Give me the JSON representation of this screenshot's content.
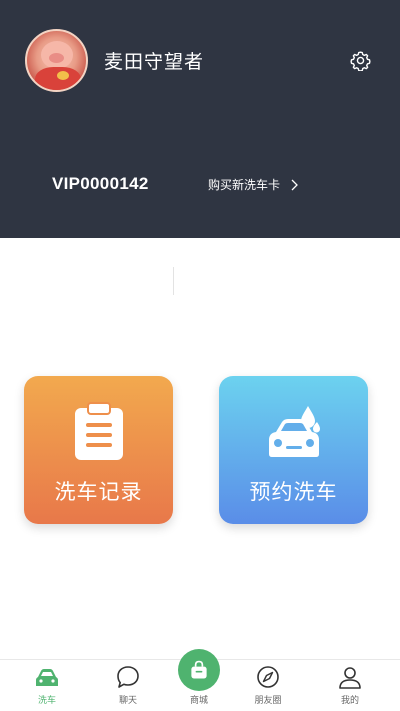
{
  "profile": {
    "username": "麦田守望者",
    "vip_id": "VIP0000142",
    "buy_card_label": "购买新洗车卡"
  },
  "tiles": [
    {
      "label": "洗车记录",
      "icon": "clipboard-icon",
      "color_top": "#f2a94e",
      "color_bottom": "#e8784a"
    },
    {
      "label": "预约洗车",
      "icon": "car-wash-icon",
      "color_top": "#6cd2ef",
      "color_bottom": "#5a8de8"
    }
  ],
  "tabbar": {
    "active_color": "#4fb36f",
    "items": [
      {
        "label": "洗车",
        "icon": "car-icon",
        "active": true
      },
      {
        "label": "聊天",
        "icon": "chat-bubble-icon",
        "active": false
      },
      {
        "label": "商城",
        "icon": "shopping-bag-icon",
        "active": false
      },
      {
        "label": "朋友圈",
        "icon": "compass-icon",
        "active": false
      },
      {
        "label": "我的",
        "icon": "user-icon",
        "active": false
      }
    ]
  },
  "colors": {
    "header_bg": "#2f3542"
  }
}
